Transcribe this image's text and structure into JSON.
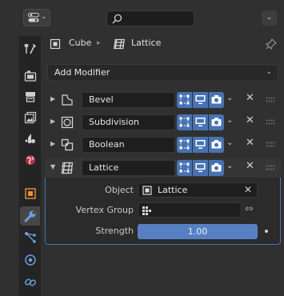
{
  "header": {
    "editor_type_chevron": "⌄",
    "options_chevron": "⌄",
    "search_value": ""
  },
  "tabs": [
    {
      "name": "tool-tab",
      "icon": "tool-icon"
    },
    {
      "name": "render-tab",
      "icon": "render-icon"
    },
    {
      "name": "output-tab",
      "icon": "output-icon"
    },
    {
      "name": "view-layer-tab",
      "icon": "view-layer-icon"
    },
    {
      "name": "scene-tab",
      "icon": "scene-icon"
    },
    {
      "name": "world-tab",
      "icon": "world-icon"
    },
    {
      "name": "object-tab",
      "icon": "object-icon"
    },
    {
      "name": "modifiers-tab",
      "icon": "wrench-icon",
      "active": true
    },
    {
      "name": "particles-tab",
      "icon": "particles-icon"
    },
    {
      "name": "physics-tab",
      "icon": "physics-icon"
    },
    {
      "name": "constraints-tab",
      "icon": "constraints-icon"
    }
  ],
  "breadcrumb": {
    "object": "Cube",
    "separator": "▸",
    "modifier": "Lattice"
  },
  "add_modifier": {
    "label": "Add Modifier",
    "chevron": "⌄"
  },
  "modifiers": [
    {
      "name": "Bevel",
      "icon": "bevel-icon",
      "expanded": false
    },
    {
      "name": "Subdivision",
      "icon": "subdivision-icon",
      "expanded": false
    },
    {
      "name": "Boolean",
      "icon": "boolean-icon",
      "expanded": false
    },
    {
      "name": "Lattice",
      "icon": "lattice-icon",
      "expanded": true
    }
  ],
  "row_controls": {
    "collapsed": "▶",
    "expanded": "▼",
    "dropdown": "⌄",
    "remove": "✕"
  },
  "lattice_panel": {
    "object_label": "Object",
    "object_value": "Lattice",
    "object_clear": "✕",
    "vertex_group_label": "Vertex Group",
    "vertex_group_value": "",
    "vertex_group_invert": "⇔",
    "strength_label": "Strength",
    "strength_value": "1.00"
  },
  "colors": {
    "accent": "#4772b3",
    "slider": "#5680c2",
    "background": "#303030",
    "tabs_bg": "#242424",
    "field_bg": "#1e1e1e"
  }
}
